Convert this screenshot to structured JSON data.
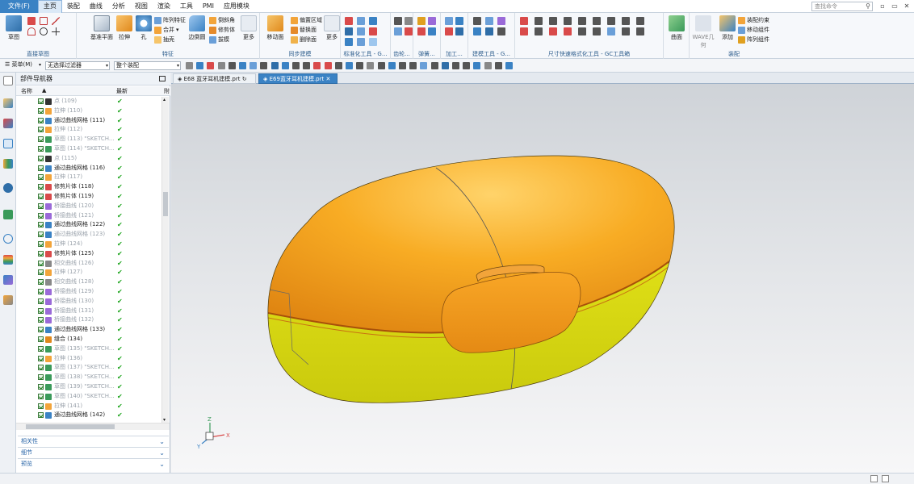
{
  "menubar": {
    "file": "文件(F)",
    "items": [
      "主页",
      "装配",
      "曲线",
      "分析",
      "视图",
      "渲染",
      "工具",
      "PMI",
      "应用模块"
    ],
    "search_placeholder": "查找命令"
  },
  "ribbon": {
    "sketch_label": "草图",
    "direct_sketch_label": "直接草图",
    "datum_plane_label": "基准平面",
    "extrude_label": "拉伸",
    "hole_label": "孔",
    "pattern_feature_label": "阵列特征",
    "unite_label": "合并",
    "shell_label": "抽壳",
    "edge_blend_label": "边倒圆",
    "chamfer_label": "倒斜角",
    "trim_body_label": "修剪体",
    "draft_label": "拔模",
    "more_label": "更多",
    "feature_group_label": "特征",
    "move_face_label": "移动面",
    "offset_region_label": "偏置区域",
    "replace_face_label": "替换面",
    "delete_face_label": "删除面",
    "sync_more_label": "更多",
    "sync_group_label": "同步建模",
    "std_tools_label": "标准化工具 - G...",
    "gear_label": "齿轮...",
    "spring_label": "弹簧...",
    "machining_label": "加工...",
    "modeling_tools_label": "建模工具 - G...",
    "dim_tools_label": "尺寸快速格式化工具 - GC工具箱",
    "surface_label": "曲面",
    "wave_label": "WAVE几何",
    "add_label": "添加",
    "assembly_constraints_label": "装配约束",
    "move_component_label": "移动组件",
    "pattern_component_label": "阵列组件",
    "assembly_group_label": "装配"
  },
  "toolbar2": {
    "menu_label": "菜单(M)",
    "filter_value": "无选择过滤器",
    "scope_value": "整个装配"
  },
  "navigator": {
    "title": "部件导航器",
    "col_name": "名称",
    "col_latest": "最新",
    "col_extra": "附",
    "rows": [
      {
        "label": "点 (109)",
        "dim": true,
        "icon": "point"
      },
      {
        "label": "拉伸 (110)",
        "dim": true,
        "icon": "extrude"
      },
      {
        "label": "通过曲线网格 (111)",
        "dim": false,
        "icon": "mesh"
      },
      {
        "label": "拉伸 (112)",
        "dim": true,
        "icon": "extrude"
      },
      {
        "label": "草图 (113) \"SKETCH...",
        "dim": true,
        "icon": "sketch"
      },
      {
        "label": "草图 (114) \"SKETCH...",
        "dim": true,
        "icon": "sketch"
      },
      {
        "label": "点 (115)",
        "dim": true,
        "icon": "point"
      },
      {
        "label": "通过曲线网格 (116)",
        "dim": false,
        "icon": "mesh"
      },
      {
        "label": "拉伸 (117)",
        "dim": true,
        "icon": "extrude"
      },
      {
        "label": "修剪片体 (118)",
        "dim": false,
        "icon": "trim"
      },
      {
        "label": "修剪片体 (119)",
        "dim": false,
        "icon": "trim"
      },
      {
        "label": "桥接曲线 (120)",
        "dim": true,
        "icon": "bridge"
      },
      {
        "label": "桥接曲线 (121)",
        "dim": true,
        "icon": "bridge"
      },
      {
        "label": "通过曲线网格 (122)",
        "dim": false,
        "icon": "mesh"
      },
      {
        "label": "通过曲线网格 (123)",
        "dim": true,
        "icon": "mesh"
      },
      {
        "label": "拉伸 (124)",
        "dim": true,
        "icon": "extrude"
      },
      {
        "label": "修剪片体 (125)",
        "dim": false,
        "icon": "trim"
      },
      {
        "label": "相交曲线 (126)",
        "dim": true,
        "icon": "intersect"
      },
      {
        "label": "拉伸 (127)",
        "dim": true,
        "icon": "extrude"
      },
      {
        "label": "相交曲线 (128)",
        "dim": true,
        "icon": "intersect"
      },
      {
        "label": "桥接曲线 (129)",
        "dim": true,
        "icon": "bridge"
      },
      {
        "label": "桥接曲线 (130)",
        "dim": true,
        "icon": "bridge"
      },
      {
        "label": "桥接曲线 (131)",
        "dim": true,
        "icon": "bridge"
      },
      {
        "label": "桥接曲线 (132)",
        "dim": true,
        "icon": "bridge"
      },
      {
        "label": "通过曲线网格 (133)",
        "dim": false,
        "icon": "mesh"
      },
      {
        "label": "缝合 (134)",
        "dim": false,
        "icon": "sew"
      },
      {
        "label": "草图 (135) \"SKETCH...",
        "dim": true,
        "icon": "sketch"
      },
      {
        "label": "拉伸 (136)",
        "dim": true,
        "icon": "extrude"
      },
      {
        "label": "草图 (137) \"SKETCH...",
        "dim": true,
        "icon": "sketch"
      },
      {
        "label": "草图 (138) \"SKETCH...",
        "dim": true,
        "icon": "sketch"
      },
      {
        "label": "草图 (139) \"SKETCH...",
        "dim": true,
        "icon": "sketch"
      },
      {
        "label": "草图 (140) \"SKETCH...",
        "dim": true,
        "icon": "sketch"
      },
      {
        "label": "拉伸 (141)",
        "dim": true,
        "icon": "extrude"
      },
      {
        "label": "通过曲线网格 (142)",
        "dim": false,
        "icon": "mesh"
      }
    ],
    "panels": [
      "相关性",
      "细节",
      "预览"
    ]
  },
  "tabs": [
    {
      "label": "E68 蓝牙耳机建模.prt",
      "active": false
    },
    {
      "label": "E69蓝牙耳机建模.prt",
      "active": true
    }
  ],
  "triad": {
    "x": "X",
    "y": "Y",
    "z": "Z"
  },
  "colors": {
    "accent": "#3a82c4",
    "upper_shell": "#f5a21b",
    "lower_shell": "#e6e61a",
    "ok_green": "#1ea51e"
  }
}
